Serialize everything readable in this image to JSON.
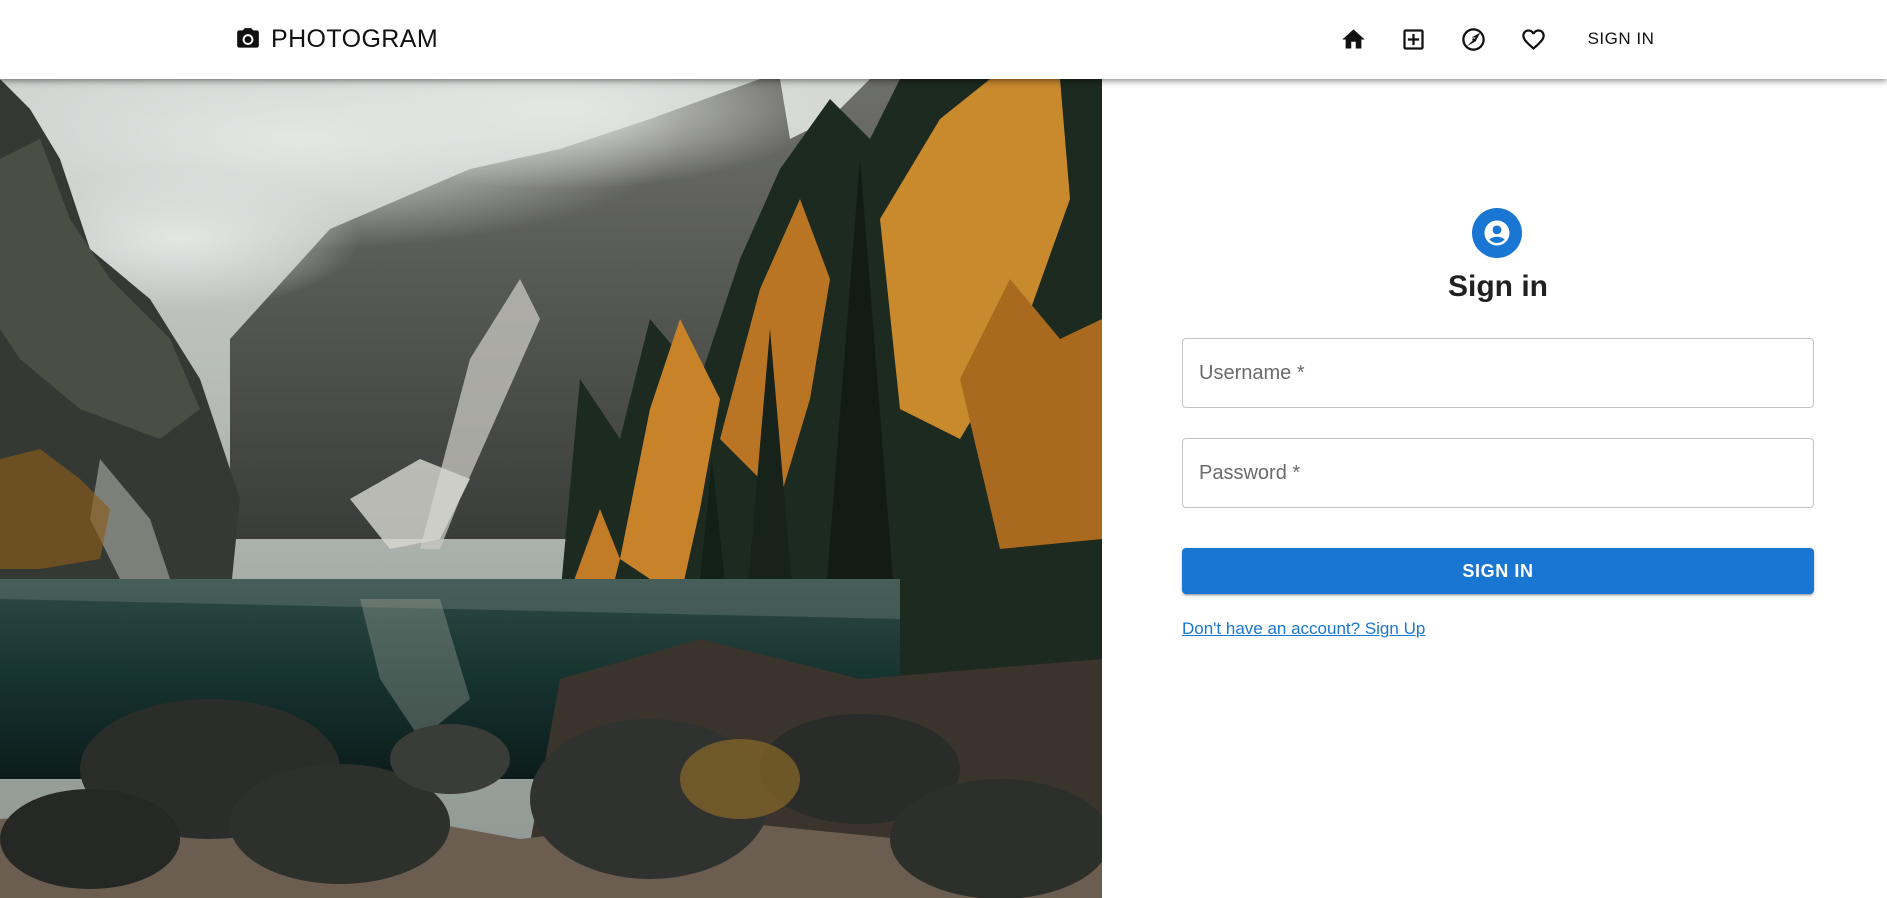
{
  "header": {
    "brand_name": "PHOTOGRAM",
    "brand_icon": "camera-icon",
    "nav_icons": [
      "home-icon",
      "add-box-icon",
      "explore-icon",
      "heart-icon"
    ],
    "signin_label": "SIGN IN"
  },
  "hero": {
    "image_subject": "mountain-lake-autumn-landscape"
  },
  "form": {
    "avatar_icon": "account-circle-icon",
    "title": "Sign in",
    "username_placeholder": "Username *",
    "username_value": "",
    "password_placeholder": "Password *",
    "password_value": "",
    "submit_label": "SIGN IN",
    "signup_link": "Don't have an account? Sign Up"
  },
  "colors": {
    "primary": "#1976d2",
    "appbar_bg": "#ffffff",
    "text": "#212121"
  }
}
